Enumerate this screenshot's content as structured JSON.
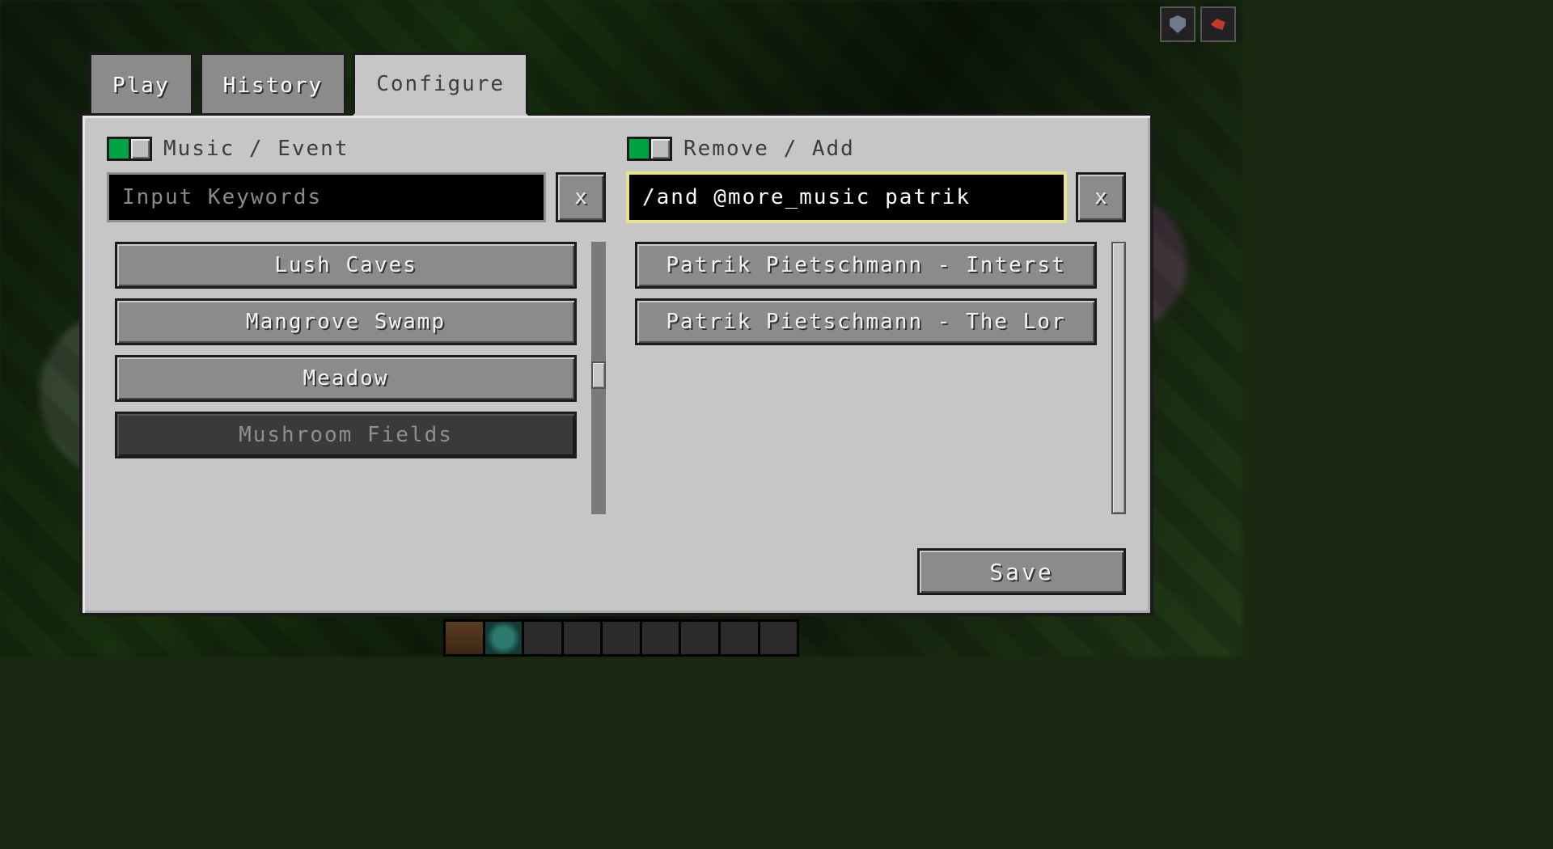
{
  "tabs": {
    "play": "Play",
    "history": "History",
    "configure": "Configure",
    "active": "configure"
  },
  "left": {
    "toggle_label": "Music / Event",
    "toggle_on": true,
    "search_value": "",
    "search_placeholder": "Input Keywords",
    "clear_label": "x",
    "items": [
      {
        "label": "Lush Caves",
        "disabled": false
      },
      {
        "label": "Mangrove Swamp",
        "disabled": false
      },
      {
        "label": "Meadow",
        "disabled": false
      },
      {
        "label": "Mushroom Fields",
        "disabled": true
      }
    ],
    "scroll": {
      "thumb_top_pct": 44,
      "thumb_height_pct": 10
    }
  },
  "right": {
    "toggle_label": "Remove / Add",
    "toggle_on": true,
    "search_value": "/and @more_music patrik",
    "search_placeholder": "",
    "clear_label": "x",
    "items": [
      {
        "label": "Patrik Pietschmann - Interst",
        "disabled": false
      },
      {
        "label": "Patrik Pietschmann - The Lor",
        "disabled": false
      }
    ],
    "scroll": {
      "thumb_top_pct": 0,
      "thumb_height_pct": 100
    }
  },
  "footer": {
    "save_label": "Save"
  }
}
